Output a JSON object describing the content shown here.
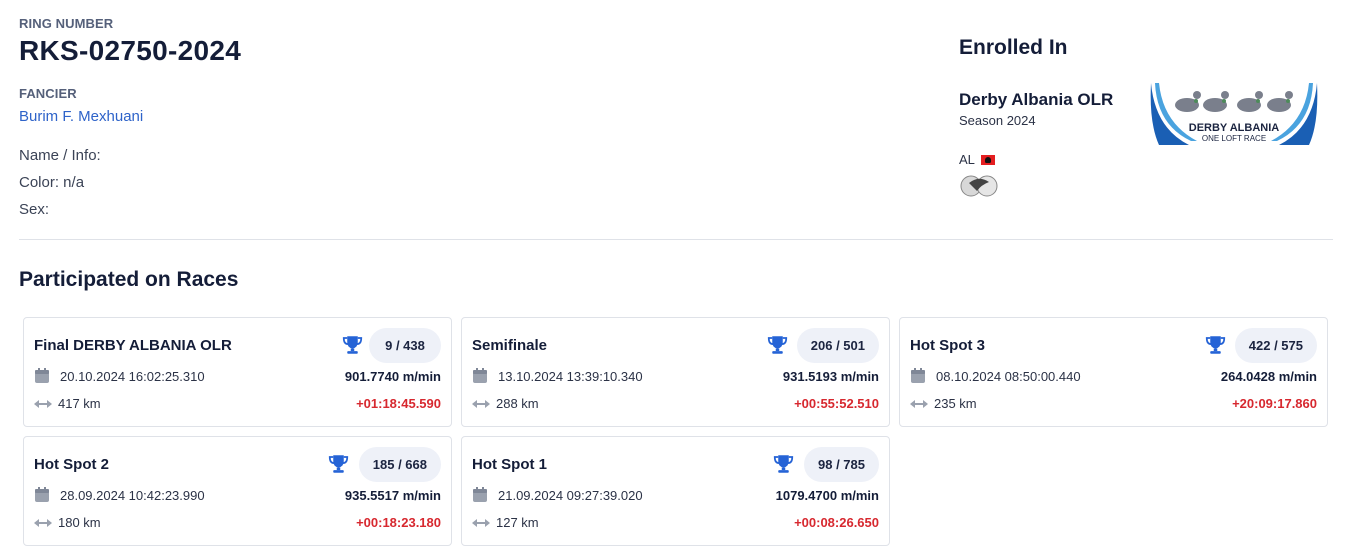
{
  "bird": {
    "ring_label": "RING NUMBER",
    "ring_number": "RKS-02750-2024",
    "fancier_label": "FANCIER",
    "fancier_name": "Burim F. Mexhuani",
    "name_info": "Name / Info:",
    "color": "Color: n/a",
    "sex": "Sex:"
  },
  "enrolled": {
    "title": "Enrolled In",
    "race_name": "Derby Albania OLR",
    "season": "Season 2024",
    "country_code": "AL",
    "logo_line1": "DERBY ALBANIA",
    "logo_line2": "ONE LOFT RACE",
    "org_logo_text": "FCI"
  },
  "races_section": {
    "title": "Participated on Races"
  },
  "races": [
    {
      "name": "Final DERBY ALBANIA OLR",
      "rank": "9 / 438",
      "datetime": "20.10.2024 16:02:25.310",
      "speed": "901.7740 m/min",
      "distance": "417 km",
      "delta": "+01:18:45.590"
    },
    {
      "name": "Semifinale",
      "rank": "206 / 501",
      "datetime": "13.10.2024 13:39:10.340",
      "speed": "931.5193 m/min",
      "distance": "288 km",
      "delta": "+00:55:52.510"
    },
    {
      "name": "Hot Spot 3",
      "rank": "422 / 575",
      "datetime": "08.10.2024 08:50:00.440",
      "speed": "264.0428 m/min",
      "distance": "235 km",
      "delta": "+20:09:17.860"
    },
    {
      "name": "Hot Spot 2",
      "rank": "185 / 668",
      "datetime": "28.09.2024 10:42:23.990",
      "speed": "935.5517 m/min",
      "distance": "180 km",
      "delta": "+00:18:23.180"
    },
    {
      "name": "Hot Spot 1",
      "rank": "98 / 785",
      "datetime": "21.09.2024 09:27:39.020",
      "speed": "1079.4700 m/min",
      "distance": "127 km",
      "delta": "+00:08:26.650"
    }
  ],
  "colors": {
    "accent": "#2e63c9",
    "delta_red": "#d7282f",
    "trophy_blue": "#2563d6",
    "icon_gray": "#9aa1ae"
  }
}
